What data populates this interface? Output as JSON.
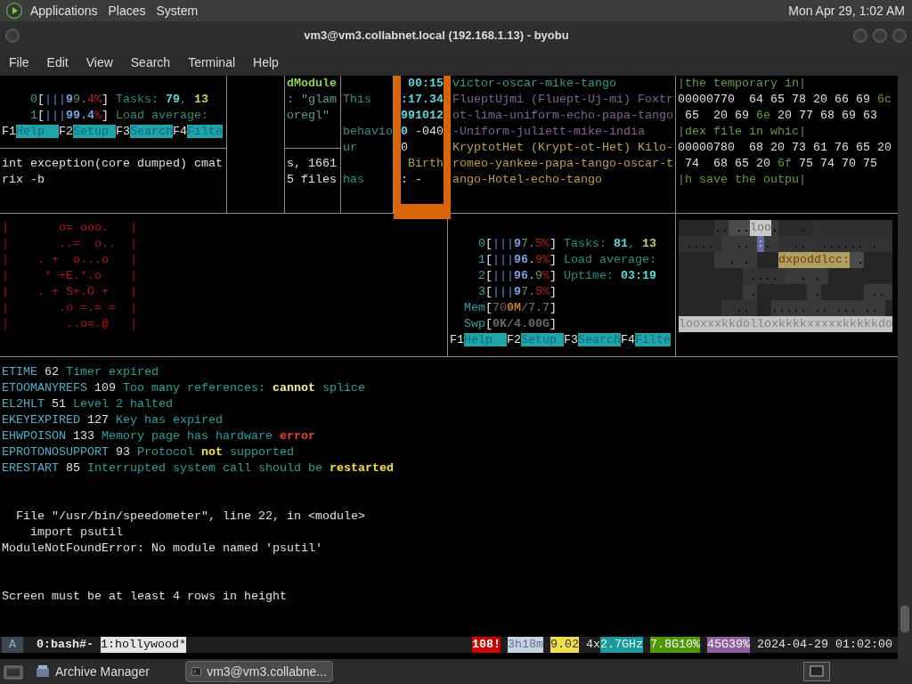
{
  "panel": {
    "menus": [
      "Applications",
      "Places",
      "System"
    ],
    "clock": "Mon Apr 29, 1:02 AM"
  },
  "window": {
    "title": "vm3@vm3.collabnet.local (192.168.1.13) - byobu",
    "menu": [
      "File",
      "Edit",
      "View",
      "Search",
      "Terminal",
      "Help"
    ]
  },
  "terminal": {
    "top_panes": [
      {
        "active": false,
        "lines": [
          [
            {
              "text": "    0",
              "kind": "dim"
            },
            {
              "text": "[",
              "kind": "bracket"
            },
            {
              "text": "|||",
              "kind": "bar"
            },
            {
              "text": "9",
              "kind": "meter"
            },
            {
              "text": "9.",
              "kind": "meterlow"
            },
            {
              "text": "4%",
              "kind": "meterhigh"
            },
            {
              "text": "]",
              "kind": "bracket"
            },
            {
              "text": " Tasks: ",
              "kind": "label"
            },
            {
              "text": "79",
              "kind": "count"
            },
            {
              "text": ", ",
              "kind": "label"
            },
            {
              "text": "13",
              "kind": "running"
            }
          ],
          [
            {
              "text": "    1",
              "kind": "dim"
            },
            {
              "text": "[",
              "kind": "bracket"
            },
            {
              "text": "|||",
              "kind": "bar"
            },
            {
              "text": "99.4",
              "kind": "meter"
            },
            {
              "text": "%",
              "kind": "meterhigh"
            },
            {
              "text": "]",
              "kind": "bracket"
            },
            {
              "text": " Load average:",
              "kind": "label"
            }
          ],
          [
            {
              "text": "F1",
              "kind": "fkey"
            },
            {
              "text": "Help  ",
              "kind": "fname"
            },
            {
              "text": "F2",
              "kind": "fkey"
            },
            {
              "text": "Setup ",
              "kind": "fname"
            },
            {
              "text": "F3",
              "kind": "fkey"
            },
            {
              "text": "Search",
              "kind": "fname"
            },
            {
              "text": "F4",
              "kind": "fkey"
            },
            {
              "text": "Filte",
              "kind": "fname"
            }
          ]
        ],
        "lower_lines": [
          [
            {
              "text": "int exception(core dumped) cmat",
              "kind": "plain"
            }
          ],
          [
            {
              "text": "rix -b",
              "kind": "plain"
            }
          ]
        ]
      },
      {
        "active": false
      },
      {
        "active": false,
        "lines": [
          [
            {
              "text": "dModule",
              "kind": "module"
            }
          ],
          [
            {
              "text": ": \"glam",
              "kind": "quote"
            }
          ],
          [
            {
              "text": "oregl\"",
              "kind": "quote"
            }
          ]
        ],
        "lower_lines": [
          [
            {
              "text": "s, 1661",
              "kind": "plain"
            }
          ],
          [
            {
              "text": "5 files",
              "kind": "plain"
            }
          ]
        ]
      },
      {
        "active": false,
        "lines": [
          [
            {
              "text": "This",
              "kind": "prose"
            }
          ],
          [
            {
              "text": "behavio",
              "kind": "prose"
            }
          ],
          [
            {
              "text": "ur",
              "kind": "prose"
            }
          ],
          [
            {
              "text": "has",
              "kind": "prose"
            }
          ]
        ]
      },
      {
        "active": true,
        "lines": [
          [
            {
              "text": " 00:15",
              "kind": "count"
            }
          ],
          [
            {
              "text": ":17.34",
              "kind": "count"
            }
          ],
          [
            {
              "text": "991012",
              "kind": "count"
            }
          ],
          [
            {
              "text": "0",
              "kind": "count"
            },
            {
              "text": " -040",
              "kind": "plain"
            }
          ],
          [
            {
              "text": "0",
              "kind": "plain"
            }
          ],
          [
            {
              "text": " Birth",
              "kind": "field"
            }
          ],
          [
            {
              "text": ": -",
              "kind": "plain"
            }
          ]
        ]
      },
      {
        "active": false,
        "lines": [
          [
            {
              "text": "victor-oscar-mike-tango",
              "kind": "heading"
            }
          ],
          [
            {
              "text": "FlueptUjmi (Fluept-Uj-mi) Foxtr",
              "kind": "entry"
            }
          ],
          [
            {
              "text": "ot-lima-uniform-echo-papa-tango",
              "kind": "entry"
            }
          ],
          [
            {
              "text": "-Uniform-juliett-mike-india",
              "kind": "entry"
            }
          ],
          [
            {
              "text": "KryptotHet (Krypt-ot-Het) Kilo-",
              "kind": "phonetic"
            }
          ],
          [
            {
              "text": "romeo-yankee-papa-tango-oscar-t",
              "kind": "phonetic"
            }
          ],
          [
            {
              "text": "ango-Hotel-echo-tango",
              "kind": "phonetic"
            }
          ]
        ]
      },
      {
        "active": false,
        "lines": [
          [
            {
              "text": "|the temporary in|",
              "kind": "ascii"
            }
          ],
          [
            {
              "text": "00000770  64 65 78 20 66 69 ",
              "kind": "plain"
            },
            {
              "text": "6c",
              "kind": "ascii"
            }
          ],
          [
            {
              "text": " 65  20 69 ",
              "kind": "plain"
            },
            {
              "text": "6e",
              "kind": "ascii"
            },
            {
              "text": " 20 77 68 69 63",
              "kind": "plain"
            }
          ],
          [
            {
              "text": "|dex file in whic|",
              "kind": "ascii"
            }
          ],
          [
            {
              "text": "00000780  68 20 73 61 76 65 20",
              "kind": "plain"
            }
          ],
          [
            {
              "text": " 74  68 65 20 ",
              "kind": "plain"
            },
            {
              "text": "6f",
              "kind": "ascii"
            },
            {
              "text": " 75 74 70 75",
              "kind": "plain"
            }
          ],
          [
            {
              "text": "|h save the outpu|",
              "kind": "ascii"
            }
          ]
        ]
      }
    ],
    "middle_panes": [
      {
        "lines": [
          [
            {
              "text": "|       o= ooo.   |",
              "kind": "art"
            }
          ],
          [
            {
              "text": "|       ..=  o..  |",
              "kind": "art"
            }
          ],
          [
            {
              "text": "|    . +  o...o   |",
              "kind": "art"
            }
          ],
          [
            {
              "text": "|     * +E.*.o    |",
              "kind": "art"
            }
          ],
          [
            {
              "text": "|    . + S+.O +   |",
              "kind": "art"
            }
          ],
          [
            {
              "text": "|       .o =.= =  |",
              "kind": "art"
            }
          ],
          [
            {
              "text": "|        ..o=.@   |",
              "kind": "art"
            }
          ]
        ]
      },
      {
        "lines": [
          [
            {
              "text": "    0",
              "kind": "dim"
            },
            {
              "text": "[",
              "kind": "bracket"
            },
            {
              "text": "|||",
              "kind": "bar"
            },
            {
              "text": "9",
              "kind": "meter"
            },
            {
              "text": "7.",
              "kind": "meterlow"
            },
            {
              "text": "5%",
              "kind": "meterhigh"
            },
            {
              "text": "]",
              "kind": "bracket"
            },
            {
              "text": " Tasks: ",
              "kind": "label"
            },
            {
              "text": "81",
              "kind": "count"
            },
            {
              "text": ", ",
              "kind": "label"
            },
            {
              "text": "13",
              "kind": "running"
            }
          ],
          [
            {
              "text": "    1",
              "kind": "dim"
            },
            {
              "text": "[",
              "kind": "bracket"
            },
            {
              "text": "|||",
              "kind": "bar"
            },
            {
              "text": "96.",
              "kind": "meter"
            },
            {
              "text": "9%",
              "kind": "meterhigh"
            },
            {
              "text": "]",
              "kind": "bracket"
            },
            {
              "text": " Load average:",
              "kind": "label"
            }
          ],
          [
            {
              "text": "    2",
              "kind": "dim"
            },
            {
              "text": "[",
              "kind": "bracket"
            },
            {
              "text": "|||",
              "kind": "bar"
            },
            {
              "text": "96.",
              "kind": "meter"
            },
            {
              "text": "9",
              "kind": "meterlow"
            },
            {
              "text": "%",
              "kind": "meterhigh"
            },
            {
              "text": "]",
              "kind": "bracket"
            },
            {
              "text": " Uptime: ",
              "kind": "label"
            },
            {
              "text": "03:19",
              "kind": "count"
            }
          ],
          [
            {
              "text": "    3",
              "kind": "dim"
            },
            {
              "text": "[",
              "kind": "bracket"
            },
            {
              "text": "|||",
              "kind": "bar"
            },
            {
              "text": "9",
              "kind": "meter"
            },
            {
              "text": "7.",
              "kind": "meterlow"
            },
            {
              "text": "5%",
              "kind": "meterhigh"
            },
            {
              "text": "]",
              "kind": "bracket"
            }
          ],
          [
            {
              "text": "  Mem",
              "kind": "dim"
            },
            {
              "text": "[",
              "kind": "bracket"
            },
            {
              "text": "70",
              "kind": "memused"
            },
            {
              "text": "0M",
              "kind": "membuf"
            },
            {
              "text": "/7.7",
              "kind": "memtotal"
            },
            {
              "text": "]",
              "kind": "bracket"
            }
          ],
          [
            {
              "text": "  Swp",
              "kind": "dim"
            },
            {
              "text": "[",
              "kind": "bracket"
            },
            {
              "text": "0K/4.00G",
              "kind": "swap"
            },
            {
              "text": "]",
              "kind": "bracket"
            }
          ],
          [
            {
              "text": "F1",
              "kind": "fkey"
            },
            {
              "text": "Help  ",
              "kind": "fname"
            },
            {
              "text": "F2",
              "kind": "fkey"
            },
            {
              "text": "Setup ",
              "kind": "fname"
            },
            {
              "text": "F3",
              "kind": "fkey"
            },
            {
              "text": "Search",
              "kind": "fname"
            },
            {
              "text": "F4",
              "kind": "fkey"
            },
            {
              "text": "Filte",
              "kind": "fname"
            }
          ]
        ]
      },
      {
        "texts": [
          {
            "text": "loo",
            "kind": "highlight"
          },
          {
            "text": ":",
            "kind": "accent"
          },
          {
            "text": "dxpoddlcc:",
            "kind": "warm"
          },
          {
            "text": "looxxxkkdolloxkkkkxxxxxkkkkkdo",
            "kind": "strip"
          }
        ]
      }
    ],
    "output_lines": [
      [
        {
          "text": "ETIME",
          "kind": "errname"
        },
        {
          "text": " 62 ",
          "kind": "plain"
        },
        {
          "text": "Timer expired",
          "kind": "message"
        }
      ],
      [
        {
          "text": "ETOOMANYREFS",
          "kind": "errname"
        },
        {
          "text": " 109 ",
          "kind": "plain"
        },
        {
          "text": "Too many references: ",
          "kind": "message"
        },
        {
          "text": "cannot",
          "kind": "strong"
        },
        {
          "text": " splice",
          "kind": "message"
        }
      ],
      [
        {
          "text": "EL2HLT",
          "kind": "errname"
        },
        {
          "text": " 51 ",
          "kind": "plain"
        },
        {
          "text": "Level 2 halted",
          "kind": "message"
        }
      ],
      [
        {
          "text": "EKEYEXPIRED",
          "kind": "errname"
        },
        {
          "text": " 127 ",
          "kind": "plain"
        },
        {
          "text": "Key has expired",
          "kind": "message"
        }
      ],
      [
        {
          "text": "EHWPOISON",
          "kind": "errname"
        },
        {
          "text": " 133 ",
          "kind": "plain"
        },
        {
          "text": "Memory page has hardware ",
          "kind": "message"
        },
        {
          "text": "error",
          "kind": "error"
        }
      ],
      [
        {
          "text": "EPROTONOSUPPORT",
          "kind": "errname"
        },
        {
          "text": " 93 ",
          "kind": "plain"
        },
        {
          "text": "Protocol ",
          "kind": "message"
        },
        {
          "text": "not",
          "kind": "warn"
        },
        {
          "text": " supported",
          "kind": "message"
        }
      ],
      [
        {
          "text": "ERESTART",
          "kind": "errname"
        },
        {
          "text": " 85 ",
          "kind": "plain"
        },
        {
          "text": "Interrupted system call should be ",
          "kind": "message"
        },
        {
          "text": "restarted",
          "kind": "warn"
        }
      ],
      [
        {
          "text": "  File \"/usr/bin/speedometer\", line 22, in <module>",
          "kind": "plain"
        }
      ],
      [
        {
          "text": "    import psutil",
          "kind": "plain"
        }
      ],
      [
        {
          "text": "ModuleNotFoundError: No module named 'psutil'",
          "kind": "plain"
        }
      ],
      [
        {
          "text": "Screen must be at least 4 rows in height",
          "kind": "plain"
        }
      ]
    ],
    "status_bar": {
      "left": [
        {
          "text": "A",
          "kind": "mode"
        },
        {
          "text": "0:bash#-",
          "kind": "window"
        },
        {
          "text": "1:hollywood*",
          "kind": "current"
        }
      ],
      "right": [
        {
          "text": "108!",
          "kind": "alert"
        },
        {
          "text": "3h18m",
          "kind": "uptime"
        },
        {
          "text": "9.02",
          "kind": "load"
        },
        {
          "text": "4x",
          "kind": "plain"
        },
        {
          "text": "2.7GHz",
          "kind": "cpu"
        },
        {
          "text": "7.8G10%",
          "kind": "memory"
        },
        {
          "text": "45G39%",
          "kind": "disk"
        },
        {
          "text": "2024-04-29 01:02:00",
          "kind": "plain"
        }
      ]
    }
  },
  "taskbar": {
    "tasks": [
      {
        "label": "Archive Manager",
        "selected": false
      },
      {
        "label": "vm3@vm3.collabne...",
        "selected": true
      }
    ]
  }
}
